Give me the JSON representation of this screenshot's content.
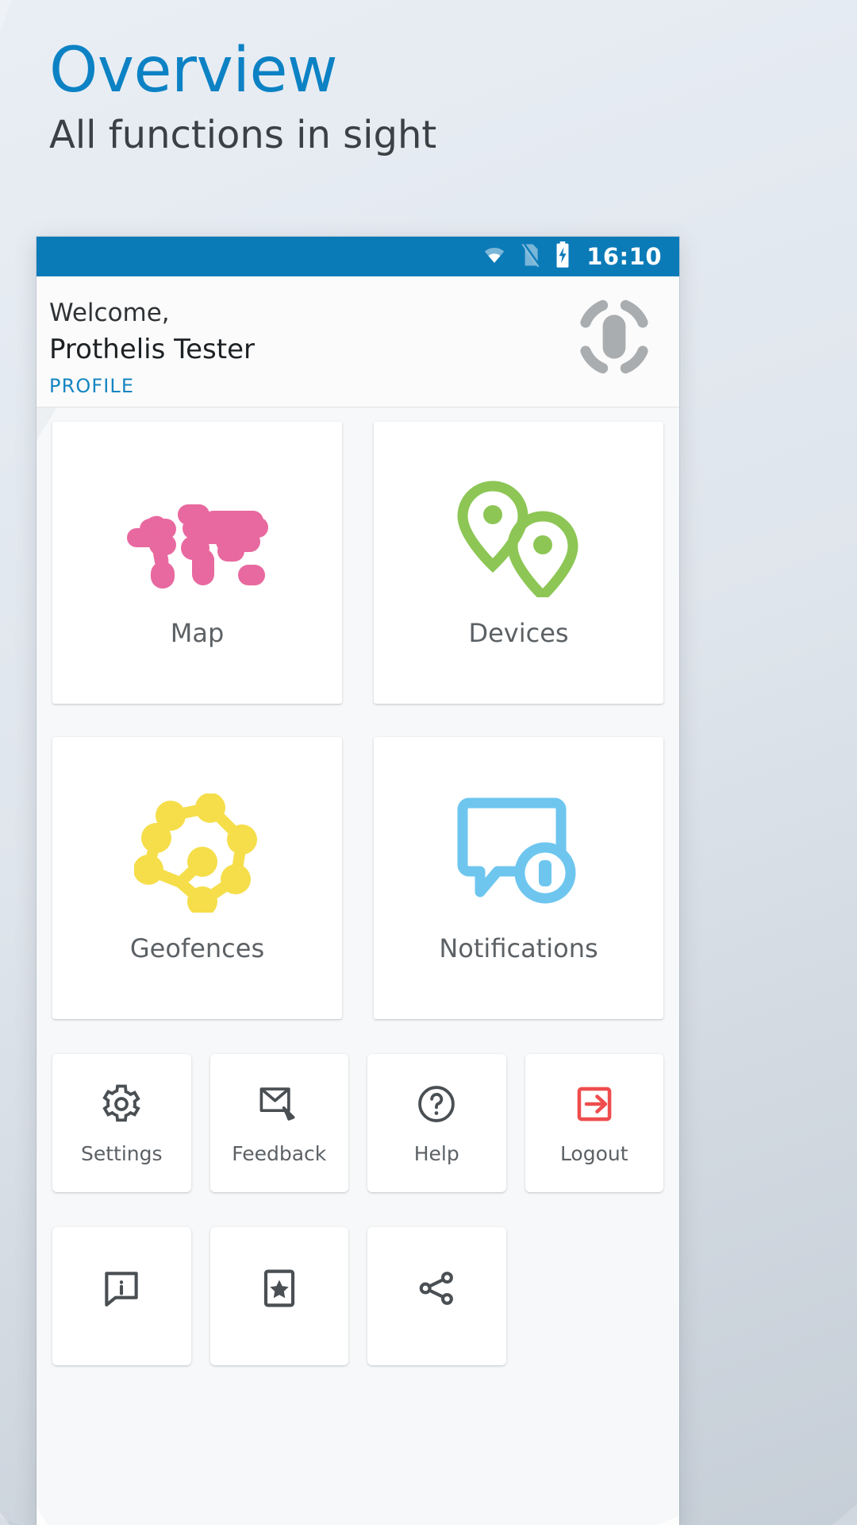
{
  "hero": {
    "title": "Overview",
    "subtitle": "All functions in sight",
    "title_color": "#0c82c4",
    "subtitle_color": "#3b4044"
  },
  "statusbar": {
    "background": "#0b7bb8",
    "clock": "16:10",
    "icons": [
      "wifi-icon",
      "sim-card-off-icon",
      "battery-charging-icon"
    ]
  },
  "welcome": {
    "greeting": "Welcome,",
    "user_name": "Prothelis Tester",
    "profile_link": "PROFILE",
    "profile_link_color": "#1585c2",
    "avatar_icon": "avatar-placeholder-icon"
  },
  "main": {
    "primary_tiles": [
      {
        "label": "Map",
        "icon": "world-map-icon",
        "color": "#e8699f"
      },
      {
        "label": "Devices",
        "icon": "map-pins-icon",
        "color": "#8dc655"
      },
      {
        "label": "Geofences",
        "icon": "geofence-icon",
        "color": "#f5de4a"
      },
      {
        "label": "Notifications",
        "icon": "notification-icon",
        "color": "#6ec6ef"
      }
    ],
    "secondary_tiles": [
      {
        "label": "Settings",
        "icon": "gear-icon",
        "color": "#4a4f53"
      },
      {
        "label": "Feedback",
        "icon": "envelope-edit-icon",
        "color": "#4a4f53"
      },
      {
        "label": "Help",
        "icon": "question-circle-icon",
        "color": "#4a4f53"
      },
      {
        "label": "Logout",
        "icon": "logout-arrow-icon",
        "color": "#ef4d4d"
      }
    ],
    "tertiary_tiles": [
      {
        "label": "",
        "icon": "info-bubble-icon",
        "color": "#4a4f53"
      },
      {
        "label": "",
        "icon": "rate-star-icon",
        "color": "#4a4f53"
      },
      {
        "label": "",
        "icon": "share-icon",
        "color": "#4a4f53"
      }
    ]
  }
}
